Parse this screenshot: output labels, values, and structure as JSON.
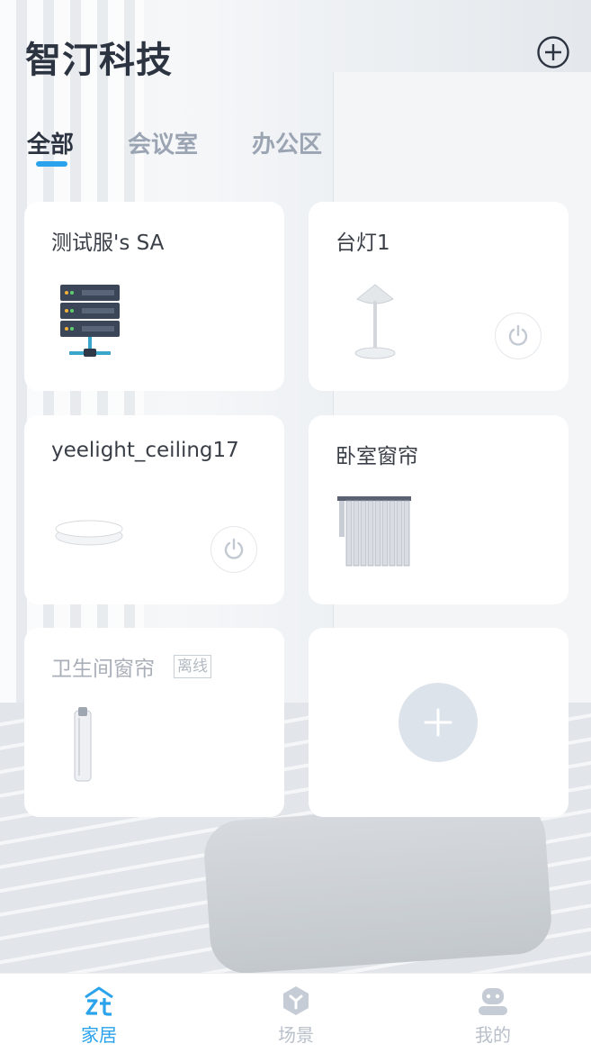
{
  "header": {
    "title": "智汀科技",
    "add_icon": "plus-circle-icon"
  },
  "tabs": [
    {
      "label": "全部",
      "active": true
    },
    {
      "label": "会议室",
      "active": false
    },
    {
      "label": "办公区",
      "active": false
    }
  ],
  "devices": [
    {
      "name": "测试服's SA",
      "icon": "server-icon",
      "has_power": false,
      "offline": false
    },
    {
      "name": "台灯1",
      "icon": "desk-lamp-icon",
      "has_power": true,
      "offline": false
    },
    {
      "name": "yeelight_ceiling17",
      "icon": "ceiling-light-icon",
      "has_power": true,
      "offline": false
    },
    {
      "name": "卧室窗帘",
      "icon": "curtain-icon",
      "has_power": false,
      "offline": false
    },
    {
      "name": "卫生间窗帘",
      "icon": "curtain-motor-icon",
      "has_power": false,
      "offline": true,
      "status_badge": "离线"
    }
  ],
  "add_device": {
    "icon": "plus-icon"
  },
  "bottom_nav": [
    {
      "label": "家居",
      "icon": "home-zt-icon",
      "active": true
    },
    {
      "label": "场景",
      "icon": "scene-hexagon-icon",
      "active": false
    },
    {
      "label": "我的",
      "icon": "profile-robot-icon",
      "active": false
    }
  ],
  "colors": {
    "accent": "#2aa3ec",
    "title": "#2d3441",
    "inactive": "#9aa4b2",
    "card": "#ffffff"
  }
}
